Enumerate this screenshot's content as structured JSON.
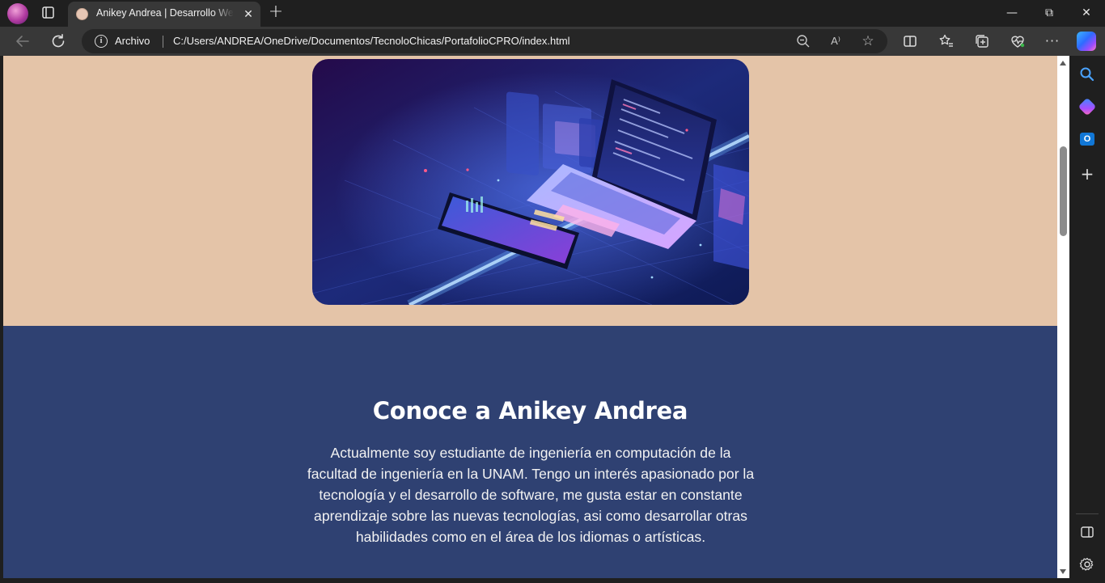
{
  "browser": {
    "tab": {
      "title": "Anikey Andrea | Desarrollo Web Portafolio",
      "close_glyph": "✕"
    },
    "new_tab_glyph": "+",
    "window_controls": {
      "minimize": "—",
      "maximize": "⧉",
      "close": "✕"
    },
    "toolbar": {
      "scheme_label": "Archivo",
      "url": "C:/Users/ANDREA/OneDrive/Documentos/TecnoloChicas/PortafolioCPRO/index.html",
      "read_aloud_glyph": "A⁾",
      "more_glyph": "···"
    },
    "sidebar": {
      "outlook_letter": "O"
    }
  },
  "page": {
    "hero_image_alt": "Ilustración isométrica de una laptop con paneles de datos",
    "about": {
      "title": "Conoce a Anikey Andrea",
      "text": "Actualmente soy estudiante de ingeniería en computación de la facultad de ingeniería en la UNAM. Tengo un interés apasionado por la tecnología y el desarrollo de software, me gusta estar en constante aprendizaje sobre las nuevas tecnologías, asi como desarrollar otras habilidades como en el área de los idiomas o artísticas."
    }
  },
  "colors": {
    "hero_bg": "#e4c4a8",
    "about_bg": "#2f4172",
    "browser_chrome": "#1f1f1f",
    "toolbar": "#383838"
  },
  "icons": {
    "profile": "profile-avatar",
    "tab_actions": "tab-actions-icon",
    "back": "back-arrow-icon",
    "reload": "reload-icon",
    "info": "info-icon",
    "zoom": "zoom-out-icon",
    "read_aloud": "read-aloud-icon",
    "favorite": "star-icon",
    "split": "split-screen-icon",
    "favorites": "favorites-icon",
    "collections": "collections-icon",
    "performance": "performance-icon",
    "more": "more-icon",
    "copilot": "copilot-icon"
  }
}
